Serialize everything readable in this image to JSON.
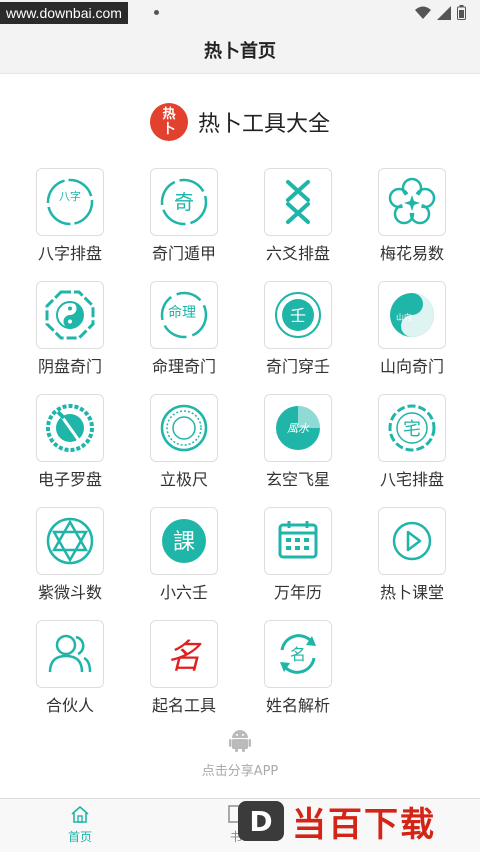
{
  "status_bar": {
    "watermark": "www.downbai.com"
  },
  "header": {
    "title": "热卜首页"
  },
  "brand": {
    "logo_top": "热",
    "logo_bottom": "卜",
    "title": "热卜工具大全"
  },
  "tools": [
    {
      "label": "八字排盘",
      "glyph": "八字",
      "icon": "bazi-icon"
    },
    {
      "label": "奇门遁甲",
      "glyph": "奇",
      "icon": "qimen-icon"
    },
    {
      "label": "六爻排盘",
      "glyph": "",
      "icon": "liuyao-icon"
    },
    {
      "label": "梅花易数",
      "glyph": "",
      "icon": "plum-blossom-icon"
    },
    {
      "label": "阴盘奇门",
      "glyph": "",
      "icon": "yinyang-bagua-icon"
    },
    {
      "label": "命理奇门",
      "glyph": "命理",
      "icon": "mingli-icon"
    },
    {
      "label": "奇门穿壬",
      "glyph": "壬",
      "icon": "ren-icon"
    },
    {
      "label": "山向奇门",
      "glyph": "山向",
      "icon": "shanxiang-icon"
    },
    {
      "label": "电子罗盘",
      "glyph": "",
      "icon": "compass-icon"
    },
    {
      "label": "立极尺",
      "glyph": "",
      "icon": "ruler-ring-icon"
    },
    {
      "label": "玄空飞星",
      "glyph": "風水",
      "icon": "fengshui-icon"
    },
    {
      "label": "八宅排盘",
      "glyph": "宅",
      "icon": "bazhai-icon"
    },
    {
      "label": "紫微斗数",
      "glyph": "",
      "icon": "star-of-david-icon"
    },
    {
      "label": "小六壬",
      "glyph": "課",
      "icon": "ke-icon"
    },
    {
      "label": "万年历",
      "glyph": "",
      "icon": "calendar-icon"
    },
    {
      "label": "热卜课堂",
      "glyph": "",
      "icon": "play-icon"
    },
    {
      "label": "合伙人",
      "glyph": "",
      "icon": "partners-icon"
    },
    {
      "label": "起名工具",
      "glyph": "名",
      "icon": "naming-icon"
    },
    {
      "label": "姓名解析",
      "glyph": "名",
      "icon": "name-analysis-icon"
    }
  ],
  "share": {
    "label": "点击分享APP",
    "icon": "android-icon"
  },
  "tabbar": {
    "home": "首页",
    "second": "书"
  },
  "watermark_br": {
    "badge": "D",
    "text": "当百下载"
  },
  "colors": {
    "accent": "#1fb5a8",
    "brand_red": "#e2412d",
    "naming_red": "#e02020"
  }
}
